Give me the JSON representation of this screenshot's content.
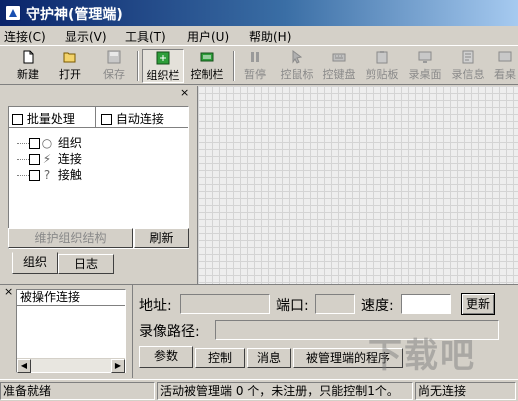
{
  "window": {
    "title": "守护神(管理端)"
  },
  "menu": [
    {
      "label": "连接(C)"
    },
    {
      "label": "显示(V)"
    },
    {
      "label": "工具(T)"
    },
    {
      "label": "用户(U)"
    },
    {
      "label": "帮助(H)"
    }
  ],
  "toolbar": {
    "buttons": [
      {
        "label": "新建",
        "icon": "new-file-icon",
        "enabled": true
      },
      {
        "label": "打开",
        "icon": "open-folder-icon",
        "enabled": true
      },
      {
        "label": "保存",
        "icon": "save-disk-icon",
        "enabled": false
      },
      {
        "label": "组织栏",
        "icon": "org-bar-icon",
        "enabled": true,
        "pressed": true
      },
      {
        "label": "控制栏",
        "icon": "control-bar-icon",
        "enabled": true
      },
      {
        "label": "暂停",
        "icon": "pause-icon",
        "enabled": false
      },
      {
        "label": "控鼠标",
        "icon": "mouse-icon",
        "enabled": false
      },
      {
        "label": "控键盘",
        "icon": "keyboard-icon",
        "enabled": false
      },
      {
        "label": "剪贴板",
        "icon": "clipboard-icon",
        "enabled": false
      },
      {
        "label": "录桌面",
        "icon": "record-desktop-icon",
        "enabled": false
      },
      {
        "label": "录信息",
        "icon": "record-info-icon",
        "enabled": false
      },
      {
        "label": "看桌",
        "icon": "view-desktop-icon",
        "enabled": false
      }
    ]
  },
  "org_panel": {
    "close": "×",
    "batch_label": "批量处理",
    "auto_connect_label": "自动连接",
    "tree": [
      {
        "label": "组织",
        "glyph": "○"
      },
      {
        "label": "连接",
        "glyph": "⚡"
      },
      {
        "label": "接触",
        "glyph": "?"
      }
    ],
    "maintain_button": "维护组织结构",
    "refresh_button": "刷新",
    "tabs": [
      {
        "label": "组织"
      },
      {
        "label": "日志"
      }
    ]
  },
  "connection_list": {
    "close": "×",
    "header": "被操作连接"
  },
  "control_panel": {
    "address_label": "地址:",
    "address_value": "",
    "port_label": "端口:",
    "port_value": "",
    "speed_label": "速度:",
    "speed_value": "",
    "update_button": "更新",
    "record_path_label": "录像路径:",
    "record_path_value": "",
    "tabs": [
      {
        "label": "参数"
      },
      {
        "label": "控制"
      },
      {
        "label": "消息"
      },
      {
        "label": "被管理端的程序"
      }
    ]
  },
  "status": {
    "ready": "准备就绪",
    "summary": "活动被管理端 0 个，未注册，只能控制1个。",
    "connection": "尚无连接"
  },
  "watermark": "下载吧"
}
